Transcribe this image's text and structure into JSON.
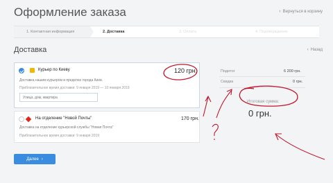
{
  "page": {
    "title": "Оформление заказа",
    "back_to_cart": "Вернуться в корзину"
  },
  "steps": [
    {
      "label": "1. Контактная информация",
      "state": "done"
    },
    {
      "label": "2. Доставка",
      "state": "active"
    },
    {
      "label": "3. Оплата",
      "state": "future"
    },
    {
      "label": "4. Подтверждение",
      "state": "future"
    }
  ],
  "delivery": {
    "title": "Доставка",
    "back_label": "Назад",
    "options": [
      {
        "name": "Курьер по Киеву",
        "description": "Доставка нашим курьером в пределах города Киев.",
        "time": "Приблизительное время доставки: 9 января 2019 — 10 января 2019",
        "price": "120 грн.",
        "selected": true,
        "address_placeholder": "Улица, дом, квартира"
      },
      {
        "name": "На отделение \"Новой Почты\"",
        "description": "Доставка на отделение курьерской службы \"Новая Почта\"",
        "time": "Приблизительное время доставки: 9 января 2019",
        "price": "170 грн.",
        "selected": false
      }
    ]
  },
  "summary": {
    "subtotal_label": "Подитог",
    "subtotal_value": "6 200 грн.",
    "discount_label": "Скидка",
    "discount_value": "0 грн.",
    "total_label": "Итоговая сумма:",
    "total_value": "0 грн."
  },
  "actions": {
    "next_label": "Далее"
  },
  "colors": {
    "accent": "#3a8dde",
    "annotation": "#c0162b"
  }
}
